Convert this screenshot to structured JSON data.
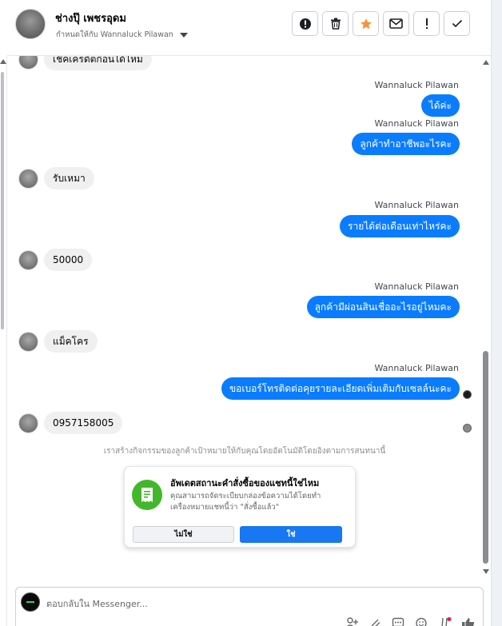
{
  "header": {
    "contact_name": "ช่างปุ๊ เพชรอุดม",
    "assigned_label": "กำหนดให้กับ Wannaluck Pilawan",
    "actions": [
      {
        "name": "alert-circle-button",
        "icon": "alert-circle-icon"
      },
      {
        "name": "delete-button",
        "icon": "trash-icon"
      },
      {
        "name": "star-button",
        "icon": "star-icon"
      },
      {
        "name": "mail-button",
        "icon": "envelope-icon"
      },
      {
        "name": "important-button",
        "icon": "exclamation-icon"
      },
      {
        "name": "done-button",
        "icon": "check-icon"
      }
    ]
  },
  "messages": [
    {
      "dir": "in",
      "text": "เช็คเครดิตก่อนได้ไหม"
    },
    {
      "dir": "out",
      "sender": "Wannaluck Pilawan",
      "text": "ได้ค่ะ"
    },
    {
      "dir": "out",
      "sender": "Wannaluck Pilawan",
      "text": "ลูกค้าทำอาชีพอะไรคะ"
    },
    {
      "dir": "in",
      "text": "รับเหมา"
    },
    {
      "dir": "out",
      "sender": "Wannaluck Pilawan",
      "text": "รายได้ต่อเดือนเท่าไหร่คะ"
    },
    {
      "dir": "in",
      "text": "50000"
    },
    {
      "dir": "out",
      "sender": "Wannaluck Pilawan",
      "text": "ลูกค้ามีผ่อนสินเชื่ออะไรอยู่ไหมคะ"
    },
    {
      "dir": "in",
      "text": "แม็คโคร"
    },
    {
      "dir": "out",
      "sender": "Wannaluck Pilawan",
      "text": "ขอเบอร์โทรติดต่อคุยรายละเอียดเพิ่มเติมกับเซลล์นะคะ"
    },
    {
      "dir": "in",
      "text": "0957158005"
    }
  ],
  "system_note": "เราสร้างกิจกรรมของลูกค้าเป้าหมายให้กับคุณโดยอัตโนมัติโดยอิงตามการสนทนานี้",
  "order_card": {
    "icon": "receipt-icon",
    "title": "อัพเดตสถานะคำสั่งซื้อของแชทนี้ใช่ไหม",
    "body": "คุณสามารถจัดระเบียบกล่องข้อความได้โดยทำเครื่องหมายแชทนี้ว่า \"สั่งซื้อแล้ว\"",
    "no_label": "ไม่ใช่",
    "yes_label": "ใช่"
  },
  "composer": {
    "placeholder": "ตอบกลับใน Messenger..."
  },
  "colors": {
    "outgoing_bubble": "#0a7cff",
    "incoming_bubble": "#f0f0f0",
    "primary_button": "#1877f2",
    "card_icon": "#42b72a",
    "star": "#f7923b"
  }
}
